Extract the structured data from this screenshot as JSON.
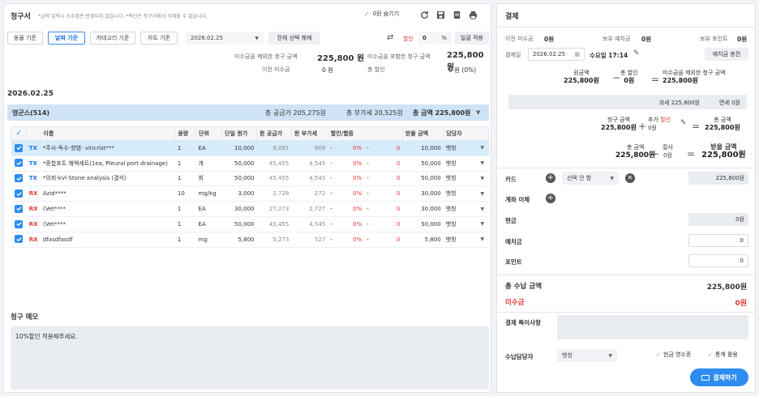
{
  "left": {
    "title": "청구서",
    "notice": "*금액 입력시 소수점은 반영되지 않습니다. *백신은 청구서에서 삭제할 수 없습니다.",
    "hide_zero_label": "0원 숨기기",
    "filters": [
      "동물 기준",
      "날짜 기준",
      "카테고리 기준",
      "차트 기준"
    ],
    "date_value": "2026.02.25",
    "deselect_all": "전체 선택 해제",
    "discount_label": "할인",
    "discount_value": "0",
    "percent": "%",
    "apply_all": "일괄 적용",
    "summary": {
      "excl_unpaid_label": "미수금을 제외한 청구 금액",
      "excl_unpaid_value": "225,800 원",
      "incl_unpaid_label": "미수금을 포함한 청구 금액",
      "incl_unpaid_value": "225,800 원",
      "prev_unpaid_label": "이전 미수금",
      "prev_unpaid_value": "0 원",
      "total_discount_label": "총 할인",
      "total_discount_value": "0 원 (0%)"
    },
    "group_date": "2026.02.25",
    "group": {
      "name": "영군스(514)",
      "supply": "총 공급가 205,275원",
      "vat": "총 부가세 20,525원",
      "total": "총 금액 225,800원"
    },
    "columns": [
      "이름",
      "용량",
      "단위",
      "단일 원가",
      "원 공급가",
      "원 부가세",
      "할인/할증",
      "받을 금액",
      "담당자"
    ],
    "rows": [
      {
        "type": "TX",
        "name": "*주사-독수-향염- vincrist***",
        "qty": "1",
        "unit": "EA",
        "price": "10,000",
        "supply": "9,091",
        "vat": "909",
        "d1": "-",
        "pct": "0%",
        "d2": "-",
        "dval": "0",
        "amount": "10,000",
        "staff": "뱃칭",
        "selected": true
      },
      {
        "type": "TX",
        "name": "*종합포트 해액세트(1ea, Pleural port drainage)",
        "qty": "1",
        "unit": "개",
        "price": "50,000",
        "supply": "45,455",
        "vat": "4,545",
        "d1": "-",
        "pct": "0%",
        "d2": "-",
        "dval": "0",
        "amount": "50,000",
        "staff": "뱃칭",
        "selected": false
      },
      {
        "type": "TX",
        "name": "*의뢰-kvl-Stone analysis (결석)",
        "qty": "1",
        "unit": "회",
        "price": "50,000",
        "supply": "45,455",
        "vat": "4,545",
        "d1": "-",
        "pct": "0%",
        "d2": "-",
        "dval": "0",
        "amount": "50,000",
        "staff": "뱃칭",
        "selected": false
      },
      {
        "type": "RX",
        "name": "Azid****",
        "qty": "10",
        "unit": "mg/kg",
        "price": "3,000",
        "supply": "2,728",
        "vat": "272",
        "d1": "-",
        "pct": "0%",
        "d2": "-",
        "dval": "0",
        "amount": "30,000",
        "staff": "뱃칭",
        "selected": false
      },
      {
        "type": "RX",
        "name": "(Vet****",
        "qty": "1",
        "unit": "EA",
        "price": "30,000",
        "supply": "27,273",
        "vat": "2,727",
        "d1": "-",
        "pct": "0%",
        "d2": "-",
        "dval": "0",
        "amount": "30,000",
        "staff": "뱃칭",
        "selected": false
      },
      {
        "type": "RX",
        "name": "(Vet****",
        "qty": "1",
        "unit": "EA",
        "price": "50,000",
        "supply": "45,455",
        "vat": "4,545",
        "d1": "-",
        "pct": "0%",
        "d2": "-",
        "dval": "0",
        "amount": "50,000",
        "staff": "뱃칭",
        "selected": false
      },
      {
        "type": "RX",
        "name": "dfasdfasdf",
        "qty": "1",
        "unit": "mg",
        "price": "5,800",
        "supply": "5,273",
        "vat": "527",
        "d1": "-",
        "pct": "0%",
        "d2": "-",
        "dval": "0",
        "amount": "5,800",
        "staff": "뱃칭",
        "selected": false
      }
    ],
    "memo_title": "청구 메모",
    "memo_text": "10%할인 적용해주세요."
  },
  "right": {
    "title": "결제",
    "prev_unpaid_label": "이전 미수금",
    "prev_unpaid_value": "0원",
    "deposit_label": "보유 예치금",
    "deposit_value": "0원",
    "points_label": "보유 포인트",
    "points_value": "0원",
    "pay_date_label": "결제일",
    "pay_date_value": "2026.02.25",
    "pay_time": "수요일 17:14",
    "charge_deposit": "예치금 충전",
    "calc1": {
      "a_label": "원금액",
      "a_value": "225,800원",
      "b_label": "총 할인",
      "b_value": "0원",
      "c_label": "미수금을 제외한 청구 금액",
      "c_value": "225,800원"
    },
    "tax_line": "과세 225,800원",
    "taxfree_line": "면세 0원",
    "calc2": {
      "a_label": "청구 금액",
      "a_value": "225,800원",
      "b_label_1": "추가",
      "b_label_2": "할인",
      "b_value": "0원",
      "c_label": "총 금액",
      "c_value": "225,800원"
    },
    "calc3": {
      "a_label": "총 금액",
      "a_value": "225,800원",
      "b_label": "절사",
      "b_value": "0원",
      "c_label": "받을 금액",
      "c_value": "225,800원"
    },
    "card_label": "카드",
    "card_select": "선택 안 함",
    "card_amount": "225,800원",
    "transfer_label": "계좌 이체",
    "cash_label": "현금",
    "cash_amount": "0원",
    "deposit_use_label": "예치금",
    "deposit_use_value": "0",
    "point_use_label": "포인트",
    "point_use_value": "0",
    "total_received_label": "총 수납 금액",
    "total_received_value": "225,800원",
    "unpaid_label": "미수금",
    "unpaid_value": "0원",
    "special_label": "결제 특이사항",
    "staff_label": "수납담당자",
    "staff_value": "뱃칭",
    "cash_receipt": "현금 영수증",
    "stats_use": "통계 활용",
    "pay_button": "결제하기"
  },
  "colors": {
    "accent": "#2d8cf0",
    "unpaid": "#e53935",
    "group_bar": "#cfe3f6"
  }
}
